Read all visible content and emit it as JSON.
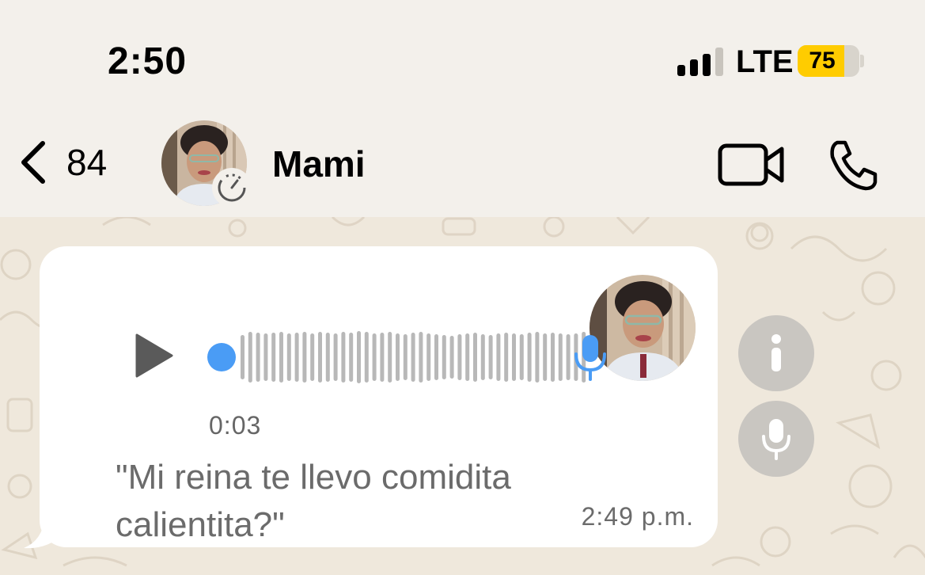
{
  "status_bar": {
    "time": "2:50",
    "network": "LTE",
    "battery_level": "75",
    "battery_color": "#ffcc00"
  },
  "header": {
    "back_count": "84",
    "contact_name": "Mami",
    "video_icon": "video-camera-icon",
    "call_icon": "phone-icon",
    "badge_icon": "disappearing-timer-icon"
  },
  "message": {
    "voice_duration": "0:03",
    "transcript": "\"Mi reina te llevo comidita calientita?\"",
    "timestamp": "2:49 p.m.",
    "accent_color": "#4a9cf5",
    "wave_color": "#b8b8b8"
  },
  "side_actions": {
    "info_icon": "info-icon",
    "mic_icon": "microphone-icon"
  }
}
